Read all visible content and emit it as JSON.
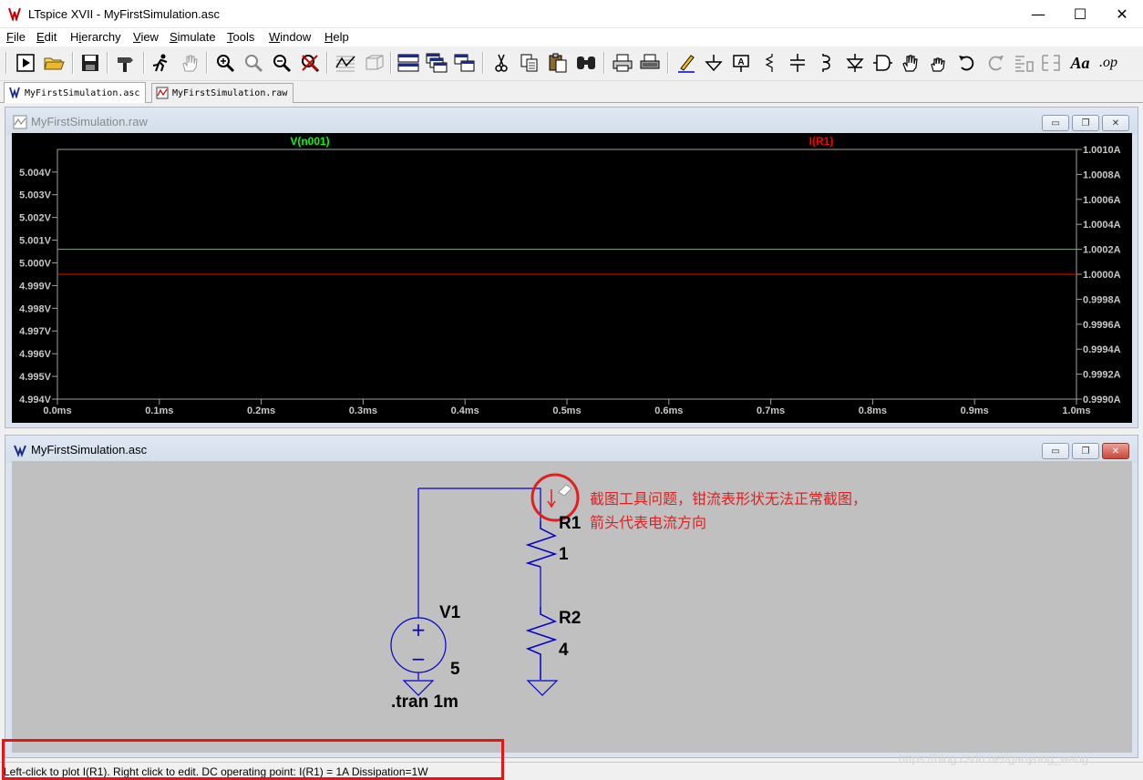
{
  "window": {
    "title": "LTspice XVII - MyFirstSimulation.asc",
    "controls": [
      "—",
      "☐",
      "✕"
    ]
  },
  "menu": [
    {
      "label": "File",
      "key": "F"
    },
    {
      "label": "Edit",
      "key": "E"
    },
    {
      "label": "Hierarchy",
      "key": "i"
    },
    {
      "label": "View",
      "key": "V"
    },
    {
      "label": "Simulate",
      "key": "S"
    },
    {
      "label": "Tools",
      "key": "T"
    },
    {
      "label": "Window",
      "key": "W"
    },
    {
      "label": "Help",
      "key": "H"
    }
  ],
  "toolbar": [
    "run-icon",
    "open-icon",
    "save-icon",
    "control-panel-icon",
    "halt-icon",
    "pan-icon",
    "zoom-in-icon",
    "zoom-fit-icon",
    "zoom-out-icon",
    "zoom-cancel-icon",
    "autorange-icon",
    "grid-icon",
    "tile-horizontal-icon",
    "cascade-icon",
    "tile-vertical-icon",
    "cut-icon",
    "copy-icon",
    "paste-icon",
    "find-icon",
    "print-icon",
    "print-preview-icon",
    "wire-icon",
    "ground-icon",
    "label-net-icon",
    "resistor-icon",
    "capacitor-icon",
    "inductor-icon",
    "diode-icon",
    "component-icon",
    "move-icon",
    "drag-icon",
    "undo-icon",
    "redo-icon",
    "rotate-icon",
    "mirror-icon",
    "text-icon",
    "spice-directive-icon"
  ],
  "toolbar_text": {
    "text_tool": "Aa",
    "directive_tool": ".op"
  },
  "tabs": [
    {
      "label": "MyFirstSimulation.asc",
      "active": true
    },
    {
      "label": "MyFirstSimulation.raw",
      "active": false
    }
  ],
  "waveform_window": {
    "title": "MyFirstSimulation.raw",
    "controls": [
      "▭",
      "❐",
      "✕"
    ]
  },
  "schematic_window": {
    "title": "MyFirstSimulation.asc",
    "controls": [
      "▭",
      "❐",
      "✕"
    ]
  },
  "chart_data": {
    "type": "line",
    "series": [
      {
        "name": "V(n001)",
        "color": "#00ff00",
        "axis": "left",
        "x": [
          0.0,
          1.0
        ],
        "y": [
          5.0,
          5.0
        ]
      },
      {
        "name": "I(R1)",
        "color": "#ff0000",
        "axis": "right",
        "x": [
          0.0,
          1.0
        ],
        "y": [
          1.0,
          1.0
        ]
      }
    ],
    "x_ticks": [
      "0.0ms",
      "0.1ms",
      "0.2ms",
      "0.3ms",
      "0.4ms",
      "0.5ms",
      "0.6ms",
      "0.7ms",
      "0.8ms",
      "0.9ms",
      "1.0ms"
    ],
    "xlim": [
      0.0,
      1.0
    ],
    "left_ticks": [
      "5.004V",
      "5.003V",
      "5.002V",
      "5.001V",
      "5.000V",
      "4.999V",
      "4.998V",
      "4.997V",
      "4.996V",
      "4.995V",
      "4.994V"
    ],
    "left_ylim": [
      4.994,
      5.004
    ],
    "right_ticks": [
      "1.0010A",
      "1.0008A",
      "1.0006A",
      "1.0004A",
      "1.0002A",
      "1.0000A",
      "0.9998A",
      "0.9996A",
      "0.9994A",
      "0.9992A",
      "0.9990A"
    ],
    "right_ylim": [
      0.999,
      1.001
    ],
    "grid": false,
    "background": "#000000"
  },
  "schematic": {
    "v1_name": "V1",
    "v1_value": "5",
    "r1_name": "R1",
    "r1_value": "1",
    "r2_name": "R2",
    "r2_value": "4",
    "directive": ".tran 1m",
    "plus_sign": "+",
    "minus_sign": "−",
    "annotation_line1": "截图工具问题，钳流表形状无法正常截图，",
    "annotation_line2": "箭头代表电流方向",
    "wire_color": "#0000cc",
    "annotation_color": "#e02020"
  },
  "status": "Left-click to plot I(R1).  Right click to edit.  DC operating point: I(R1) = 1A   Dissipation=1W",
  "watermark": "https://blog.csdn.net/gaoyong_wang"
}
